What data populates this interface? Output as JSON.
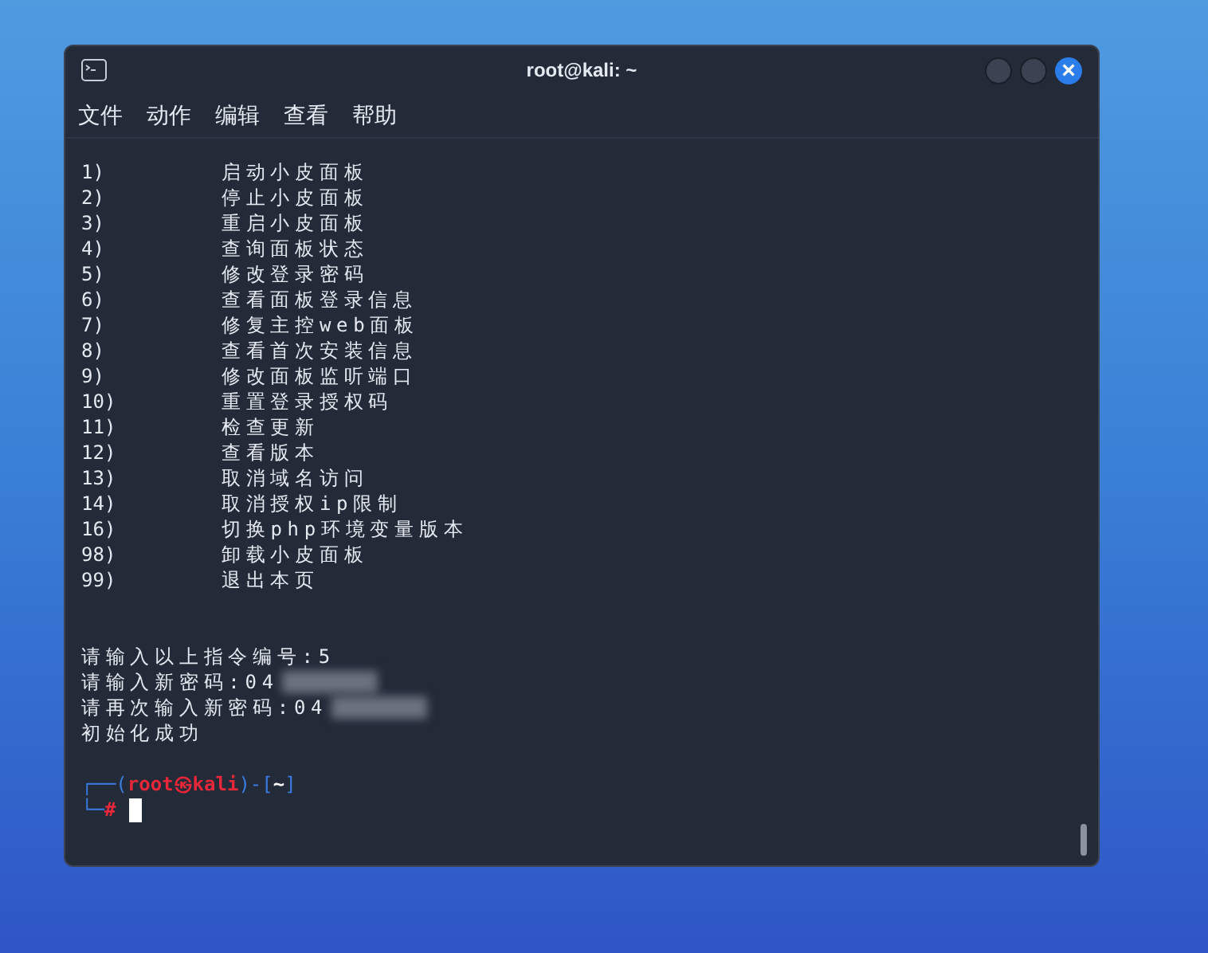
{
  "window": {
    "title": "root@kali: ~",
    "close_symbol": "×"
  },
  "menu": [
    "文件",
    "动作",
    "编辑",
    "查看",
    "帮助"
  ],
  "options": [
    {
      "number": "1)",
      "label": "启动小皮面板"
    },
    {
      "number": "2)",
      "label": "停止小皮面板"
    },
    {
      "number": "3)",
      "label": "重启小皮面板"
    },
    {
      "number": "4)",
      "label": "查询面板状态"
    },
    {
      "number": "5)",
      "label": "修改登录密码"
    },
    {
      "number": "6)",
      "label": "查看面板登录信息"
    },
    {
      "number": "7)",
      "label": "修复主控web面板"
    },
    {
      "number": "8)",
      "label": "查看首次安装信息"
    },
    {
      "number": "9)",
      "label": "修改面板监听端口"
    },
    {
      "number": "10)",
      "label": "重置登录授权码"
    },
    {
      "number": "11)",
      "label": "检查更新"
    },
    {
      "number": "12)",
      "label": "查看版本"
    },
    {
      "number": "13)",
      "label": "取消域名访问"
    },
    {
      "number": "14)",
      "label": "取消授权ip限制"
    },
    {
      "number": "16)",
      "label": "切换php环境变量版本"
    },
    {
      "number": "98)",
      "label": "卸载小皮面板"
    },
    {
      "number": "99)",
      "label": "退出本页"
    }
  ],
  "output": [
    {
      "text": "请输入以上指令编号:5",
      "redacted": false
    },
    {
      "text": "请输入新密码:04",
      "redacted": true
    },
    {
      "text": "请再次输入新密码:04",
      "redacted": true
    },
    {
      "text": "初始化成功",
      "redacted": false
    }
  ],
  "prompt": {
    "open": "┌──(",
    "user_host": "root㉿kali",
    "middle": ")-[",
    "dir": "~",
    "close": "]",
    "corner": "└─",
    "symbol": "#"
  }
}
